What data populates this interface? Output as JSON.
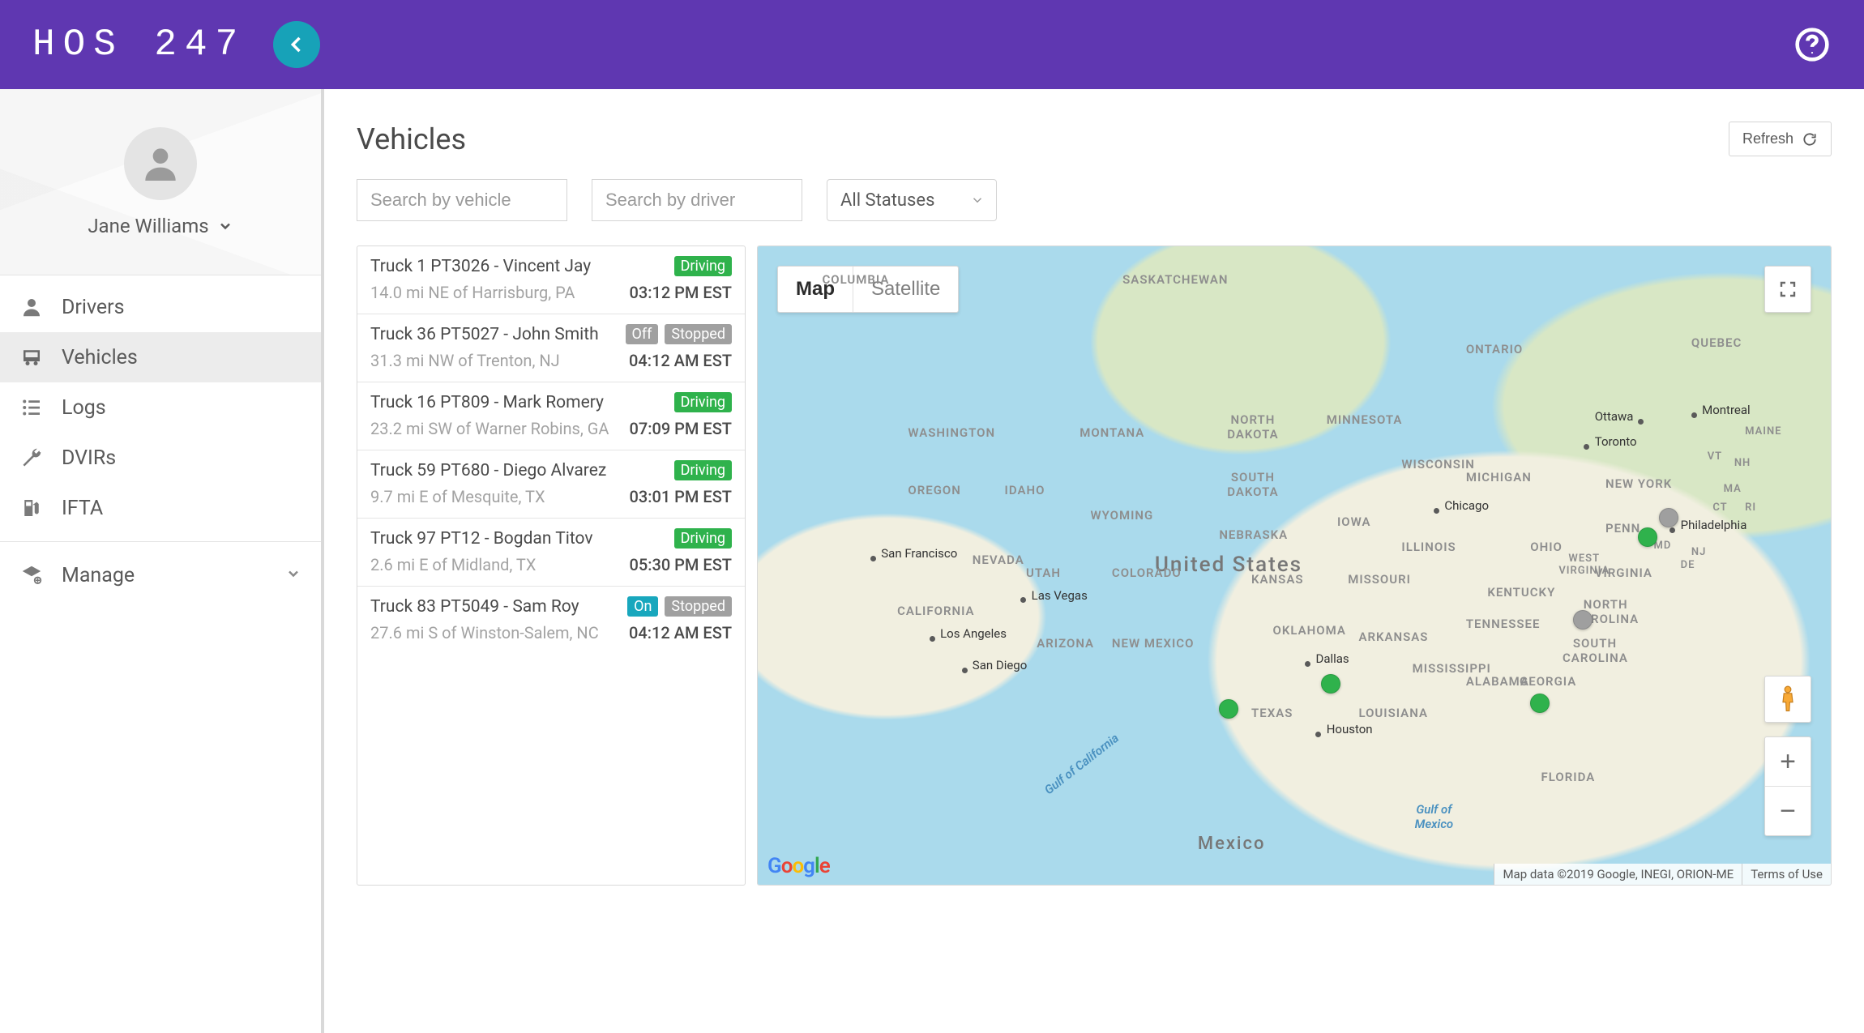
{
  "brand": "HOS 247",
  "user": {
    "name": "Jane Williams"
  },
  "nav": {
    "drivers": "Drivers",
    "vehicles": "Vehicles",
    "logs": "Logs",
    "dvirs": "DVIRs",
    "ifta": "IFTA",
    "manage": "Manage"
  },
  "page": {
    "title": "Vehicles",
    "refresh": "Refresh",
    "search_vehicle_ph": "Search by vehicle",
    "search_driver_ph": "Search by driver",
    "status_filter": "All Statuses"
  },
  "badges": {
    "driving": "Driving",
    "stopped": "Stopped",
    "off": "Off",
    "on": "On"
  },
  "vehicles": [
    {
      "title": "Truck 1 PT3026 - Vincent Jay",
      "loc": "14.0 mi NE of Harrisburg, PA",
      "time": "03:12 PM EST",
      "status": [
        "driving"
      ]
    },
    {
      "title": "Truck 36 PT5027 - John Smith",
      "loc": "31.3 mi NW of Trenton, NJ",
      "time": "04:12 AM EST",
      "status": [
        "off",
        "stopped"
      ]
    },
    {
      "title": "Truck 16 PT809 - Mark Romery",
      "loc": "23.2 mi SW of Warner Robins, GA",
      "time": "07:09 PM EST",
      "status": [
        "driving"
      ]
    },
    {
      "title": "Truck 59 PT680 - Diego Alvarez",
      "loc": "9.7 mi E of Mesquite, TX",
      "time": "03:01 PM EST",
      "status": [
        "driving"
      ]
    },
    {
      "title": "Truck 97 PT12 - Bogdan Titov",
      "loc": "2.6 mi E of Midland, TX",
      "time": "05:30 PM EST",
      "status": [
        "driving"
      ]
    },
    {
      "title": "Truck 83 PT5049 - Sam Roy",
      "loc": "27.6 mi S of Winston-Salem, NC",
      "time": "04:12 AM EST",
      "status": [
        "on",
        "stopped"
      ]
    }
  ],
  "map": {
    "view_map": "Map",
    "view_sat": "Satellite",
    "attribution": "Map data ©2019 Google, INEGI, ORION-ME",
    "terms": "Terms of Use",
    "labels": {
      "us": "United States",
      "mexico": "Mexico",
      "gulf_ca": "Gulf of California",
      "gulf_mx": "Gulf of Mexico",
      "states": {
        "washington": "Washington",
        "oregon": "Oregon",
        "california": "California",
        "nevada": "Nevada",
        "idaho": "Idaho",
        "utah": "Utah",
        "arizona": "Arizona",
        "montana": "Montana",
        "wyoming": "Wyoming",
        "colorado": "Colorado",
        "newmexico": "New Mexico",
        "texas": "Texas",
        "ndakota": "North Dakota",
        "sdakota": "South Dakota",
        "nebraska": "Nebraska",
        "kansas": "Kansas",
        "oklahoma": "Oklahoma",
        "minnesota": "Minnesota",
        "iowa": "Iowa",
        "missouri": "Missouri",
        "arkansas": "Arkansas",
        "louisiana": "Louisiana",
        "wisconsin": "Wisconsin",
        "illinois": "Illinois",
        "indiana": "",
        "michigan": "Michigan",
        "ohio": "Ohio",
        "kentucky": "Kentucky",
        "tennessee": "Tennessee",
        "mississippi": "Mississippi",
        "alabama": "Alabama",
        "georgia": "Georgia",
        "florida": "Florida",
        "scarolina": "South Carolina",
        "ncarolina": "North Carolina",
        "virginia": "Virginia",
        "wvirginia": "West Virginia",
        "penn": "Penn",
        "newyork": "New York",
        "vt": "VT",
        "nh": "NH",
        "maine": "Maine",
        "ma": "MA",
        "ct": "CT",
        "ri": "RI",
        "nj": "NJ",
        "de": "DE",
        "md": "MD",
        "ontario": "Ontario",
        "quebec": "Quebec",
        "saskatchewan": "Saskatchewan",
        "columbia": "Columbia"
      },
      "cities": {
        "sf": "San Francisco",
        "la": "Los Angeles",
        "sd": "San Diego",
        "lv": "Las Vegas",
        "dallas": "Dallas",
        "houston": "Houston",
        "chicago": "Chicago",
        "toronto": "Toronto",
        "ottawa": "Ottawa",
        "montreal": "Montreal",
        "philadelphia": "Philadelphia"
      }
    }
  }
}
